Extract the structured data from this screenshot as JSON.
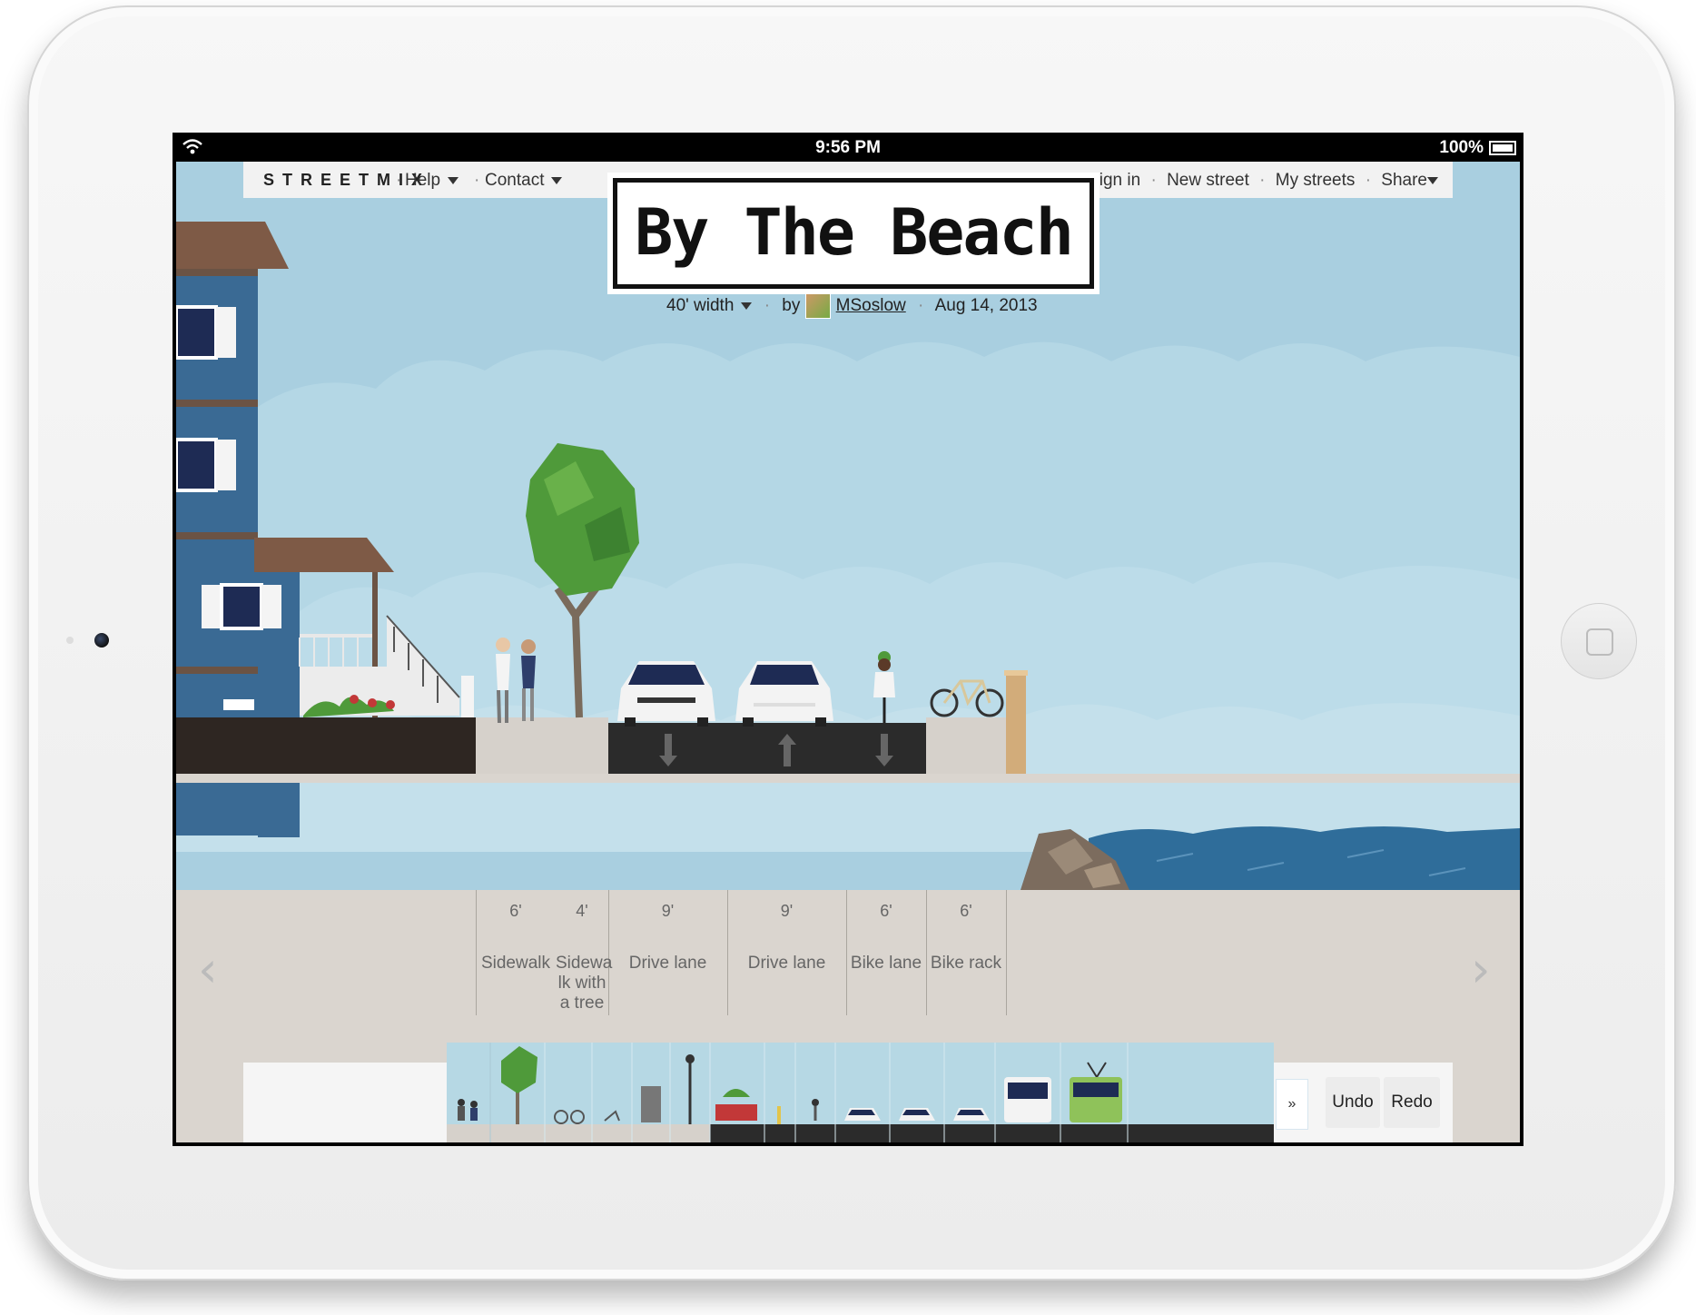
{
  "status_bar": {
    "time": "9:56 PM",
    "battery": "100%"
  },
  "menu": {
    "logo": "STREETMIX",
    "left": [
      {
        "label": "Help",
        "dropdown": true
      },
      {
        "label": "Contact",
        "dropdown": true
      }
    ],
    "right": [
      {
        "label": "Sign in"
      },
      {
        "label": "New street"
      },
      {
        "label": "My streets"
      },
      {
        "label": "Share",
        "dropdown": true
      }
    ],
    "separator": "·"
  },
  "street": {
    "title": "By The Beach",
    "width": "40' width",
    "by": "by",
    "author": "MSoslow",
    "date": "Aug 14, 2013"
  },
  "segments": [
    {
      "width": "6'",
      "name": "Sidewalk"
    },
    {
      "width": "4'",
      "name": "Sidewalk with a tree",
      "display_lines": [
        "Sidewa",
        "lk with",
        "a tree"
      ]
    },
    {
      "width": "9'",
      "name": "Drive lane"
    },
    {
      "width": "9'",
      "name": "Drive lane"
    },
    {
      "width": "6'",
      "name": "Bike lane"
    },
    {
      "width": "6'",
      "name": "Bike rack"
    }
  ],
  "navigation": {
    "prev": "‹",
    "next": "›"
  },
  "palette": {
    "more": "»",
    "undo": "Undo",
    "redo": "Redo",
    "items": [
      "sidewalk-people",
      "sidewalk-tree",
      "bike-rack",
      "bench",
      "wayfinding",
      "lamp",
      "planter-box",
      "bollard",
      "bike-lane",
      "drive-lane",
      "turn-lane",
      "parking-lane",
      "bus-lane",
      "streetcar-lane"
    ]
  },
  "colors": {
    "sky": "#a9cfe0",
    "ground": "#dad5cf",
    "asphalt": "#2b2b2b",
    "house": "#3a6a94",
    "water": "#2f6d9a"
  }
}
